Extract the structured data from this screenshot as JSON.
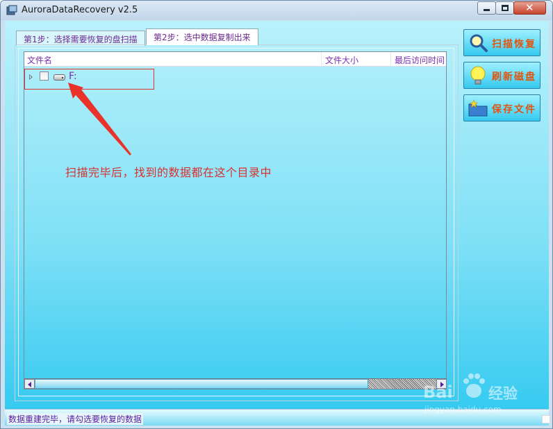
{
  "window": {
    "title": "AuroraDataRecovery v2.5",
    "close_glyph": "✕"
  },
  "tabs": [
    {
      "label": "第1步：选择需要恢复的盘扫描"
    },
    {
      "label": "第2步：选中数据复制出来"
    }
  ],
  "tree": {
    "columns": [
      "文件名",
      "文件大小",
      "最后访问时间"
    ],
    "items": [
      {
        "label": "F:",
        "checked": false,
        "icon": "drive-icon"
      }
    ]
  },
  "annotation": {
    "text": "扫描完毕后，找到的数据都在这个目录中",
    "color": "#d93030"
  },
  "side_buttons": [
    {
      "label": "扫描恢复",
      "icon": "magnifier-icon"
    },
    {
      "label": "刷新磁盘",
      "icon": "lightbulb-icon"
    },
    {
      "label": "保存文件",
      "icon": "folder-star-icon"
    }
  ],
  "status": {
    "text": "数据重建完毕，请勾选要恢复的数据"
  },
  "watermark": {
    "brand": "Bai",
    "brand_suffix": "经验",
    "url": "jingyan.baidu.com"
  },
  "colors": {
    "accent_text": "#7a2fb0",
    "button_text": "#e0560f",
    "highlight": "#e03030"
  }
}
